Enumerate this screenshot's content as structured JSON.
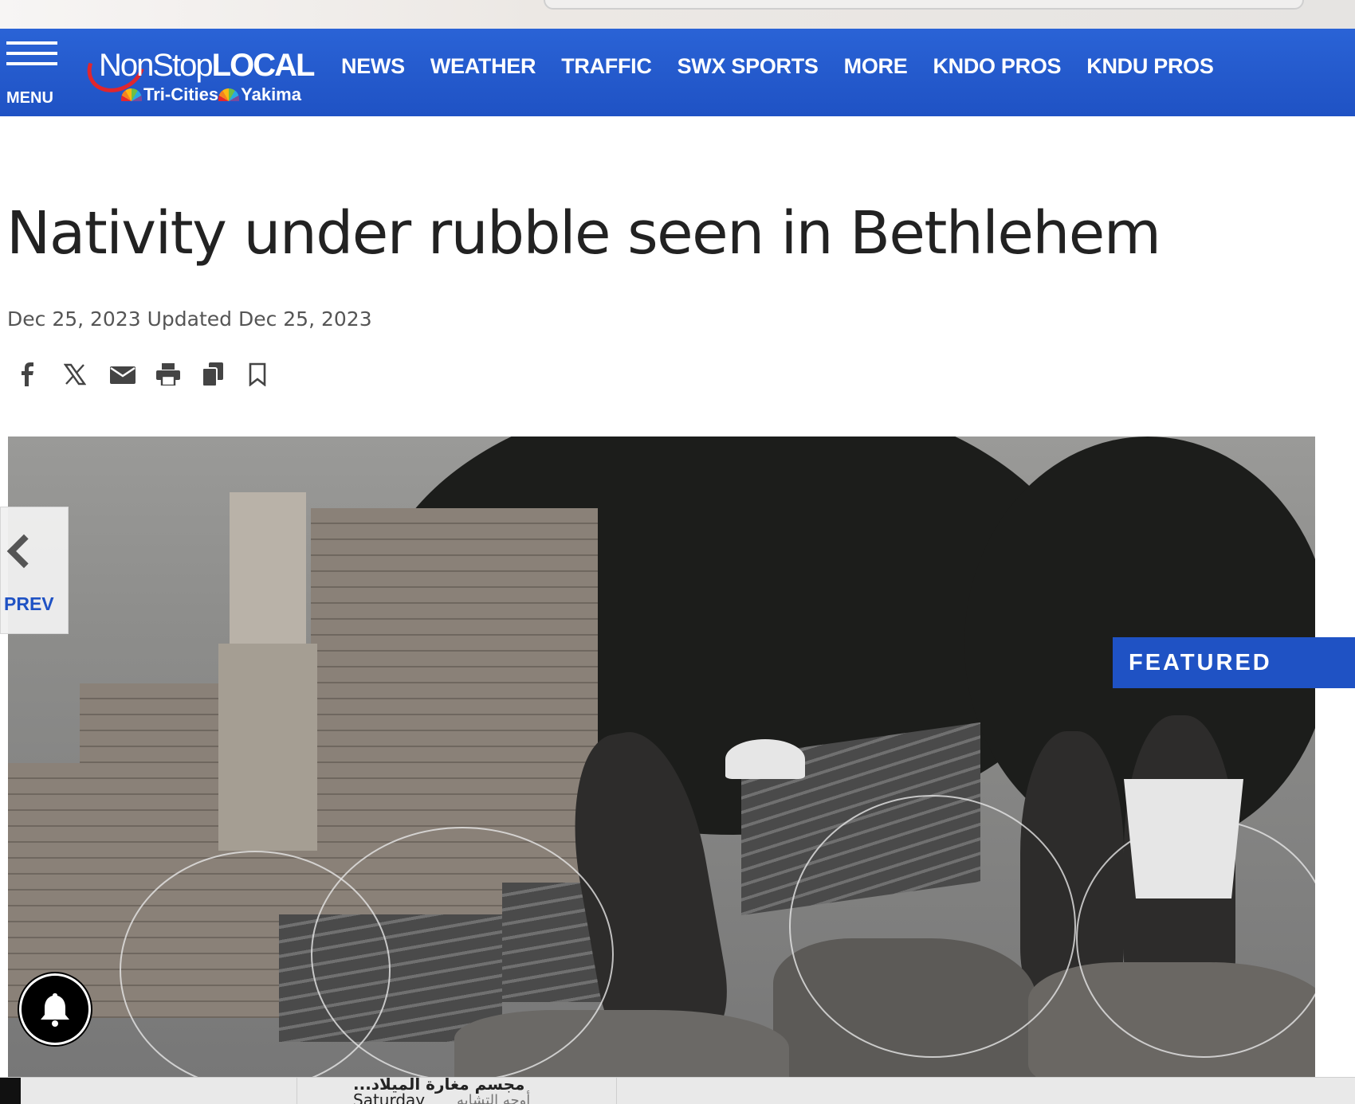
{
  "site": {
    "menu_label": "MENU",
    "logo_nonstop": "NonStop",
    "logo_local": "LOCAL",
    "logo_city1": "Tri-Cities",
    "logo_city2": "Yakima",
    "brand_color": "#1f52c4",
    "accent_color": "#e0262e"
  },
  "nav": [
    "NEWS",
    "WEATHER",
    "TRAFFIC",
    "SWX SPORTS",
    "MORE",
    "KNDO PROS",
    "KNDU PROS"
  ],
  "article": {
    "headline": "Nativity under rubble seen in Bethlehem",
    "dateline": "Dec 25, 2023 Updated Dec 25, 2023"
  },
  "share_icons": [
    "facebook-icon",
    "x-icon",
    "email-icon",
    "print-icon",
    "copy-icon",
    "bookmark-icon"
  ],
  "gallery": {
    "prev_label": "PREV",
    "featured_label": "FEATURED"
  },
  "bottom_strip": {
    "headline_ar": "مجسم مغارة الميلاد...",
    "day": "Saturday",
    "subtitle_ar": "أوجه التشابه"
  }
}
